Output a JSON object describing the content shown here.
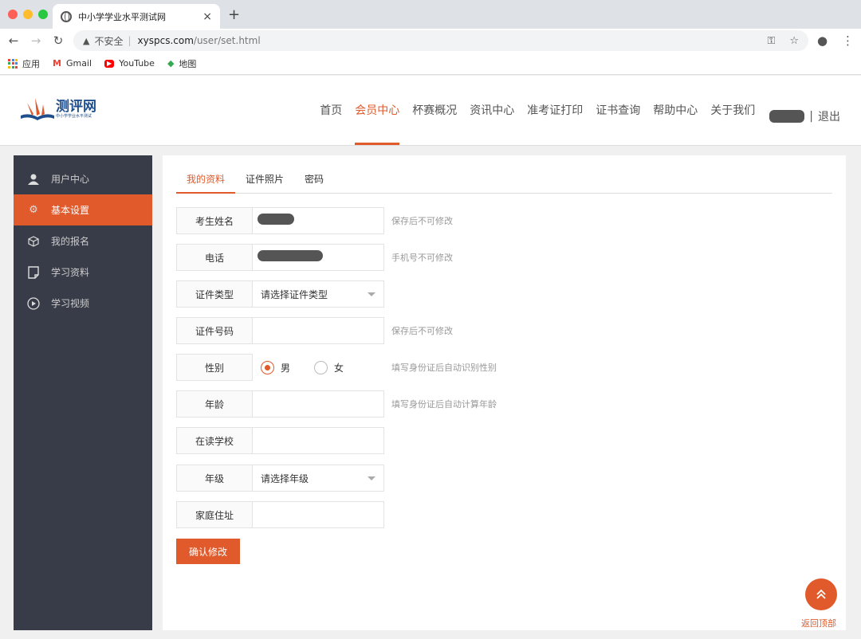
{
  "browser": {
    "tab_title": "中小学学业水平测试网",
    "tab_close": "×",
    "new_tab": "+",
    "url_warning": "不安全",
    "url_host": "xyspcs.com",
    "url_path": "/user/set.html",
    "bookmarks": [
      {
        "label": "应用",
        "icon": "apps-grid-icon"
      },
      {
        "label": "Gmail",
        "icon": "gmail-icon"
      },
      {
        "label": "YouTube",
        "icon": "youtube-icon"
      },
      {
        "label": "地图",
        "icon": "maps-icon"
      }
    ]
  },
  "site": {
    "logo_text": "测评网",
    "logo_sub": "中小学学业水平测试",
    "nav": [
      "首页",
      "会员中心",
      "杯赛概况",
      "资讯中心",
      "准考证打印",
      "证书查询",
      "帮助中心",
      "关于我们"
    ],
    "active_nav": "会员中心",
    "logout": "退出",
    "pipe": "|"
  },
  "sidebar": {
    "items": [
      {
        "label": "用户中心",
        "icon": "user-icon"
      },
      {
        "label": "基本设置",
        "icon": "gear-icon",
        "active": true
      },
      {
        "label": "我的报名",
        "icon": "cube-icon"
      },
      {
        "label": "学习资料",
        "icon": "document-icon"
      },
      {
        "label": "学习视频",
        "icon": "play-icon"
      }
    ]
  },
  "tabs": [
    "我的资料",
    "证件照片",
    "密码"
  ],
  "form": {
    "name_label": "考生姓名",
    "name_hint": "保存后不可修改",
    "phone_label": "电话",
    "phone_hint": "手机号不可修改",
    "idtype_label": "证件类型",
    "idtype_value": "请选择证件类型",
    "idno_label": "证件号码",
    "idno_hint": "保存后不可修改",
    "gender_label": "性别",
    "gender_male": "男",
    "gender_female": "女",
    "gender_hint": "填写身份证后自动识别性别",
    "age_label": "年龄",
    "age_hint": "填写身份证后自动计算年龄",
    "school_label": "在读学校",
    "grade_label": "年级",
    "grade_value": "请选择年级",
    "address_label": "家庭住址",
    "submit": "确认修改"
  },
  "back_to_top": "返回顶部",
  "colors": {
    "accent": "#e05a2b",
    "sidebar": "#383c48"
  }
}
